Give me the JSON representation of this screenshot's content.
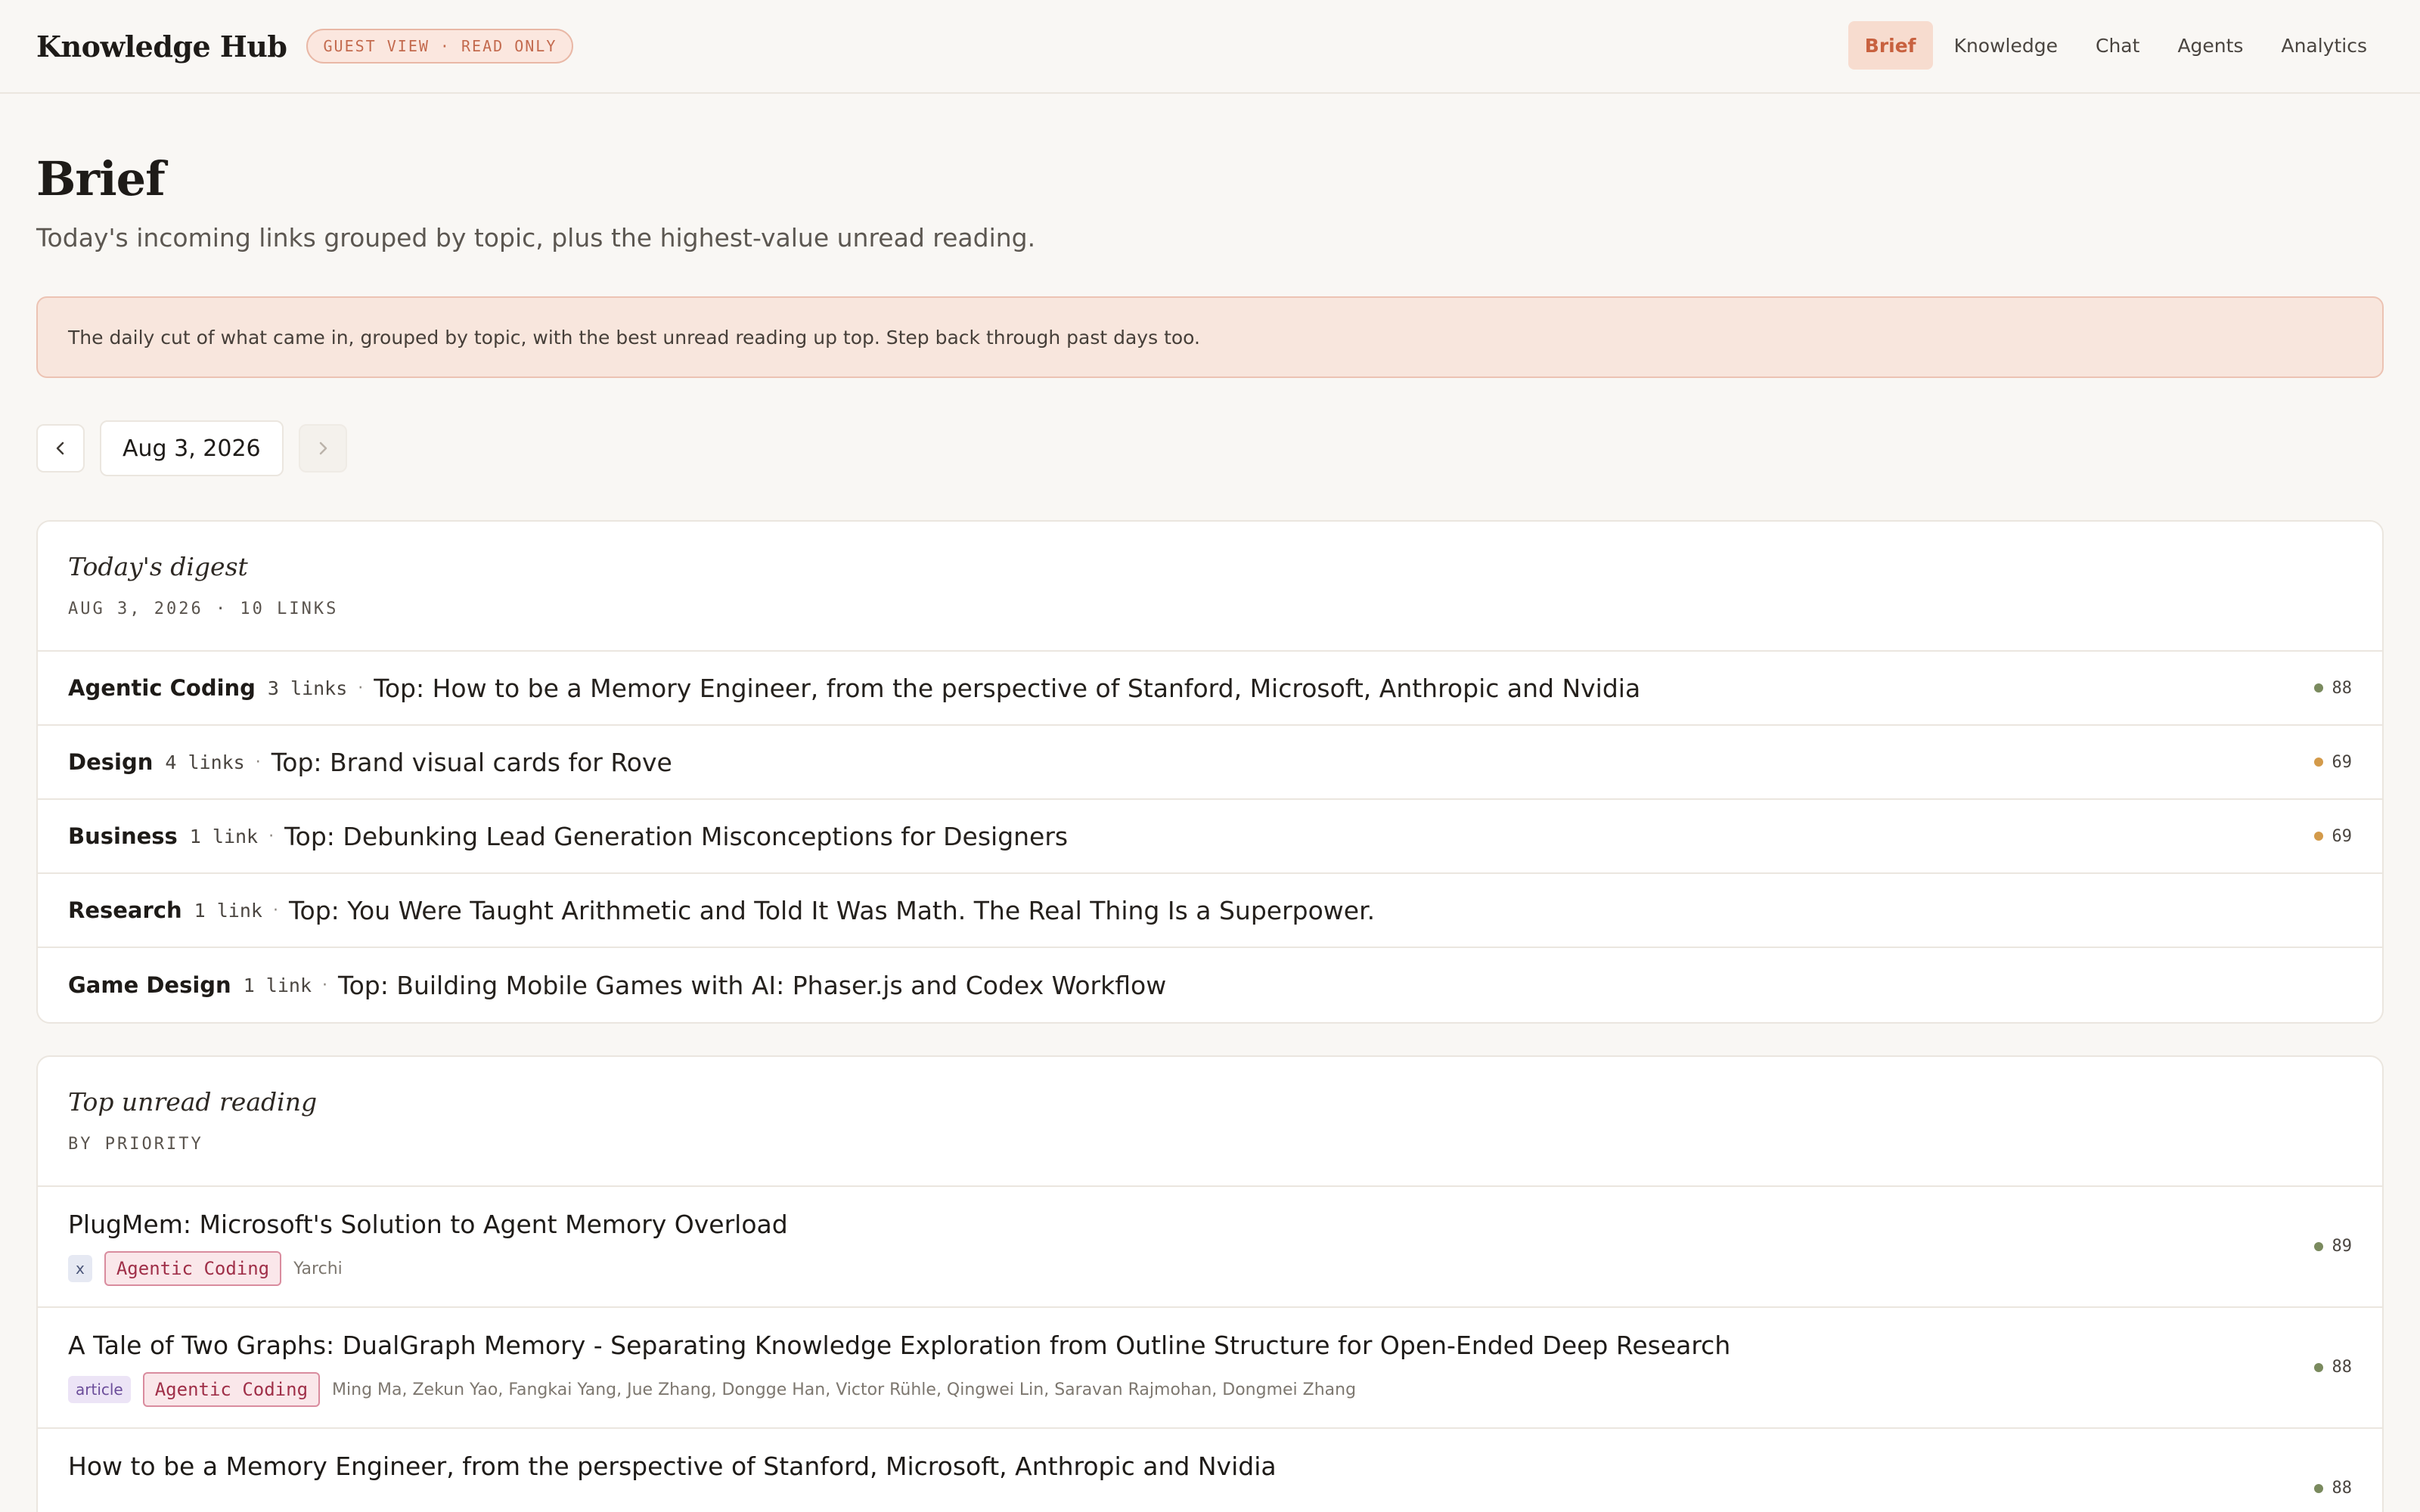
{
  "header": {
    "brand": "Knowledge Hub",
    "badge": "GUEST VIEW · READ ONLY",
    "nav": [
      {
        "label": "Brief",
        "active": true
      },
      {
        "label": "Knowledge",
        "active": false
      },
      {
        "label": "Chat",
        "active": false
      },
      {
        "label": "Agents",
        "active": false
      },
      {
        "label": "Analytics",
        "active": false
      }
    ]
  },
  "page": {
    "title": "Brief",
    "subtitle": "Today's incoming links grouped by topic, plus the highest-value unread reading.",
    "notice": "The daily cut of what came in, grouped by topic, with the best unread reading up top. Step back through past days too."
  },
  "date_nav": {
    "prev_icon": "chevron-left-icon",
    "date": "Aug 3, 2026",
    "next_icon": "chevron-right-icon"
  },
  "digest": {
    "title": "Today's digest",
    "meta": "AUG 3, 2026 · 10 LINKS",
    "rows": [
      {
        "topic": "Agentic Coding",
        "count": "3 links",
        "sep": "·",
        "top": "Top: How to be a Memory Engineer, from the perspective of Stanford, Microsoft, Anthropic and Nvidia",
        "score": "88",
        "score_color": "#7a8a5e"
      },
      {
        "topic": "Design",
        "count": "4 links",
        "sep": "·",
        "top": "Top: Brand visual cards for Rove",
        "score": "69",
        "score_color": "#d39a4a"
      },
      {
        "topic": "Business",
        "count": "1 link",
        "sep": "·",
        "top": "Top: Debunking Lead Generation Misconceptions for Designers",
        "score": "69",
        "score_color": "#d39a4a"
      },
      {
        "topic": "Research",
        "count": "1 link",
        "sep": "·",
        "top": "Top: You Were Taught Arithmetic and Told It Was Math. The Real Thing Is a Superpower.",
        "score": "",
        "score_color": ""
      },
      {
        "topic": "Game Design",
        "count": "1 link",
        "sep": "·",
        "top": "Top: Building Mobile Games with AI: Phaser.js and Codex Workflow",
        "score": "",
        "score_color": ""
      }
    ]
  },
  "reading": {
    "title": "Top unread reading",
    "meta": "BY PRIORITY",
    "items": [
      {
        "title": "PlugMem: Microsoft's Solution to Agent Memory Overload",
        "source": "x",
        "tag": "Agentic Coding",
        "authors": "Yarchi",
        "score": "89",
        "score_color": "#7a8a5e"
      },
      {
        "title": "A Tale of Two Graphs: DualGraph Memory - Separating Knowledge Exploration from Outline Structure for Open-Ended Deep Research",
        "source": "article",
        "tag": "Agentic Coding",
        "authors": "Ming Ma, Zekun Yao, Fangkai Yang, Jue Zhang, Dongge Han, Victor Rühle, Qingwei Lin, Saravan Rajmohan, Dongmei Zhang",
        "score": "88",
        "score_color": "#7a8a5e"
      },
      {
        "title": "How to be a Memory Engineer, from the perspective of Stanford, Microsoft, Anthropic and Nvidia",
        "source": "",
        "tag": "",
        "authors": "",
        "score": "88",
        "score_color": "#7a8a5e"
      }
    ]
  }
}
